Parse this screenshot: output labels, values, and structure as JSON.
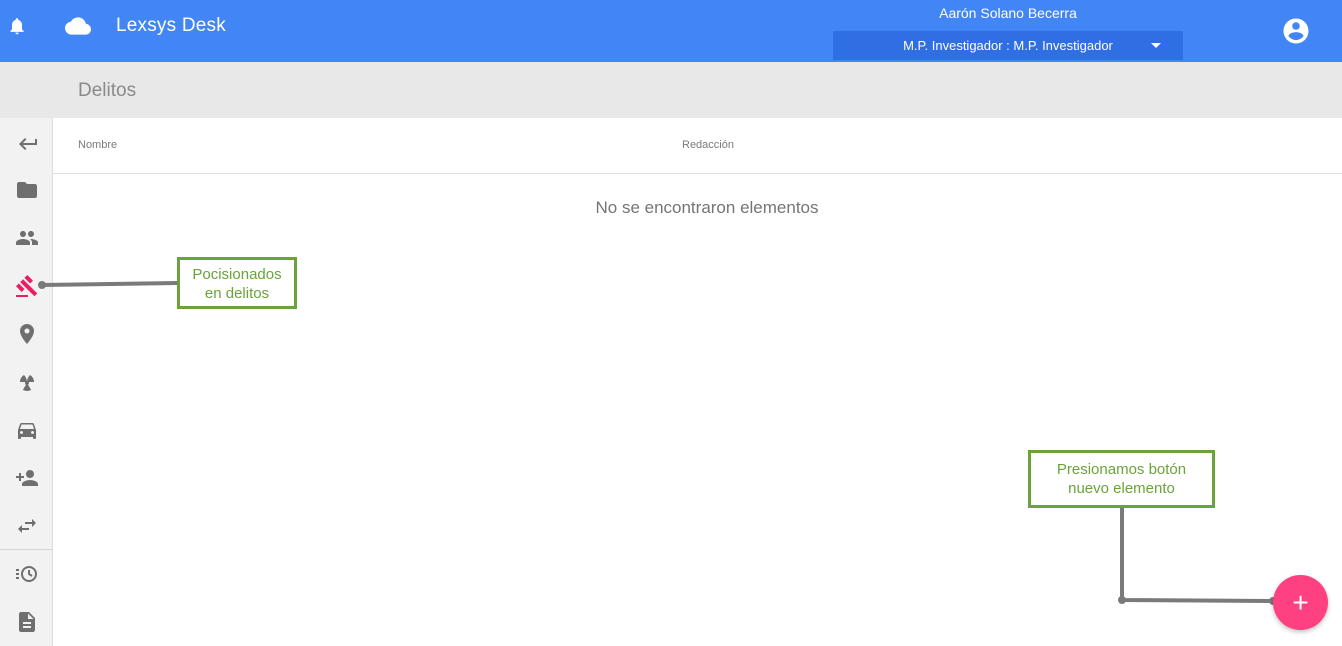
{
  "header": {
    "app_title": "Lexsys Desk",
    "user_name": "Aarón Solano Becerra",
    "role_select": "M.P. Investigador : M.P. Investigador",
    "icons": [
      "bell-icon",
      "cloud-icon",
      "account-circle-icon",
      "chevron-down-icon"
    ]
  },
  "page": {
    "title": "Delitos"
  },
  "sidebar": {
    "items": [
      {
        "icon": "back-arrow-icon",
        "active": false
      },
      {
        "icon": "folder-icon",
        "active": false
      },
      {
        "icon": "people-icon",
        "active": false
      },
      {
        "icon": "gavel-icon",
        "active": true
      },
      {
        "icon": "location-pin-icon",
        "active": false
      },
      {
        "icon": "radioactive-icon",
        "active": false
      },
      {
        "icon": "car-icon",
        "active": false
      },
      {
        "icon": "person-add-icon",
        "active": false
      },
      {
        "icon": "swap-arrows-icon",
        "active": false
      },
      {
        "icon": "history-icon",
        "active": false
      },
      {
        "icon": "document-icon",
        "active": false
      }
    ],
    "active_color": "#e91e63",
    "icon_color": "#6f6f6f"
  },
  "table": {
    "columns": [
      "Nombre",
      "Redacción"
    ],
    "empty_message": "No se encontraron elementos"
  },
  "annotations": {
    "callout_1_line_1": "Pocisionados",
    "callout_1_line_2": "en delitos",
    "callout_2_line_1": "Presionamos botón",
    "callout_2_line_2": "nuevo elemento",
    "color": "#6aa33a"
  },
  "fab": {
    "label": "+",
    "icon": "add-icon",
    "color": "#ff4081"
  },
  "colors": {
    "header": "#4285f4",
    "role_select": "#2f6fe3",
    "subheader": "#e8e8e8"
  }
}
